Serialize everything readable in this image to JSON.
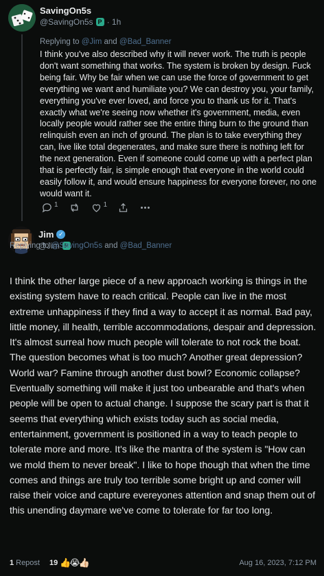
{
  "post1": {
    "display_name": "SavingOn5s",
    "handle": "@SavingOn5s",
    "badge": "P",
    "time": "· 1h",
    "reply_prefix": "Replying to",
    "reply_mention1": "@Jim",
    "reply_and": "and",
    "reply_mention2": "@Bad_Banner",
    "text": "I think you've also described why it will never work. The truth is people don't want something that works. The system is broken by design. Fuck being fair. Why be fair when we can use the force of government to get everything we want and humiliate you? We can destroy you, your family, everything you've ever loved, and force you to thank us for it. That's exactly what we're seeing now whether it's government, media, even locally people would rather see the entire thing burn to the ground than relinquish even an inch of ground. The plan is to take everything they can, live like total degenerates, and make sure there is nothing left for the next generation. Even if someone could come up with a perfect plan that is perfectly fair, is simple enough that everyone in the world could easily follow it, and would ensure happiness for everyone forever, no one would want it.",
    "actions": {
      "reply_icon": "reply-icon",
      "reply_count": "1",
      "repost_icon": "repost-icon",
      "like_icon": "heart-icon",
      "like_count": "1",
      "share_icon": "share-icon",
      "more_icon": "more-icon"
    }
  },
  "post2": {
    "display_name": "Jim",
    "handle": "@Jim",
    "badge": "P",
    "verified_icon": "verified-check-icon",
    "reply_prefix": "Replying to",
    "reply_mention1": "@SavingOn5s",
    "reply_and": "and",
    "reply_mention2": "@Bad_Banner",
    "text": "I think the other large piece of a new approach working is things in the existing system have to reach critical.  People can live in the most extreme unhappiness if they find a way to accept it as normal.  Bad pay, little money, ill health, terrible accommodations, despair and depression.  It's almost surreal how much people will tolerate to not rock the boat.  The question becomes what is too much?  Another great depression?  World war?  Famine through another dust bowl?  Economic collapse?  Eventually something will make it just too unbearable and that's when people will be open to actual change.  I suppose the scary part is that it seems that everything which exists today such as social media, entertainment, government is positioned in a way to teach people to tolerate more and more.  It's like the mantra of the system is \"How can we mold them to never break\".  I like to hope though that when the time comes and things are truly too terrible some bright up and comer will raise their voice and capture evereyones attention and snap them out of this unending daymare we've come to tolerate for far too long.",
    "repost_count": "1",
    "repost_label": "Repost",
    "reaction_count": "19",
    "reactions": "👍😭👍🏻",
    "timestamp": "Aug 16, 2023, 7:12 PM"
  },
  "colors": {
    "background": "#0b0d0c",
    "text": "#e7e9ea",
    "muted": "#8b98a5",
    "mention": "#4f6f8f",
    "badge": "#2aa88a",
    "verified": "#4aa3df"
  }
}
